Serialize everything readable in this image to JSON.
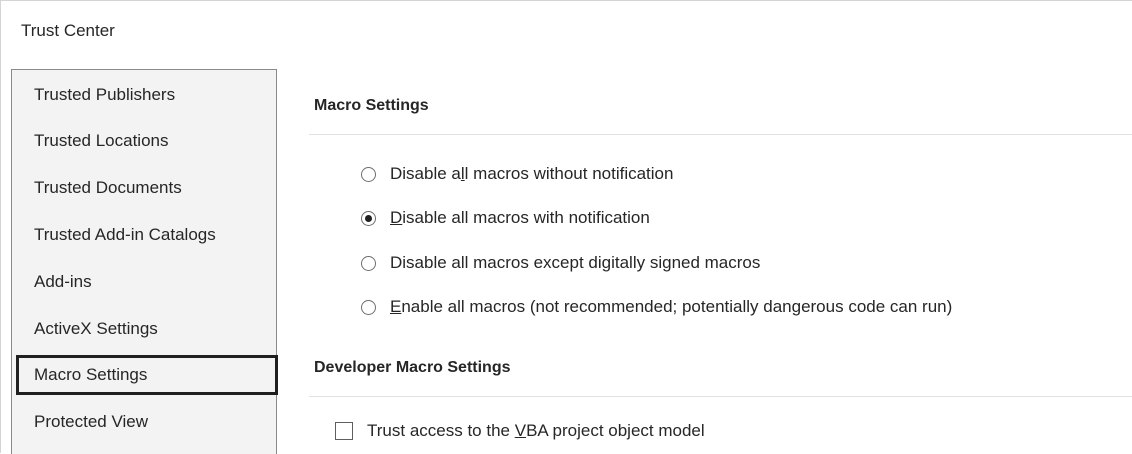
{
  "window": {
    "title": "Trust Center"
  },
  "sidebar": {
    "items": [
      {
        "label": "Trusted Publishers"
      },
      {
        "label": "Trusted Locations"
      },
      {
        "label": "Trusted Documents"
      },
      {
        "label": "Trusted Add-in Catalogs"
      },
      {
        "label": "Add-ins"
      },
      {
        "label": "ActiveX Settings"
      },
      {
        "label": "Macro Settings",
        "selected": true
      },
      {
        "label": "Protected View"
      }
    ]
  },
  "macro_settings": {
    "heading": "Macro Settings",
    "options": [
      {
        "pre": "Disable a",
        "key": "l",
        "post": "l macros without notification",
        "checked": false
      },
      {
        "pre": "",
        "key": "D",
        "post": "isable all macros with notification",
        "checked": true
      },
      {
        "pre": "Disable all macros except digitally signed macros",
        "key": "",
        "post": "",
        "checked": false
      },
      {
        "pre": "",
        "key": "E",
        "post": "nable all macros (not recommended; potentially dangerous code can run)",
        "checked": false
      }
    ]
  },
  "developer_macro_settings": {
    "heading": "Developer Macro Settings",
    "trust_vba": {
      "pre": "Trust access to the ",
      "key": "V",
      "post": "BA project object model",
      "checked": false
    }
  }
}
